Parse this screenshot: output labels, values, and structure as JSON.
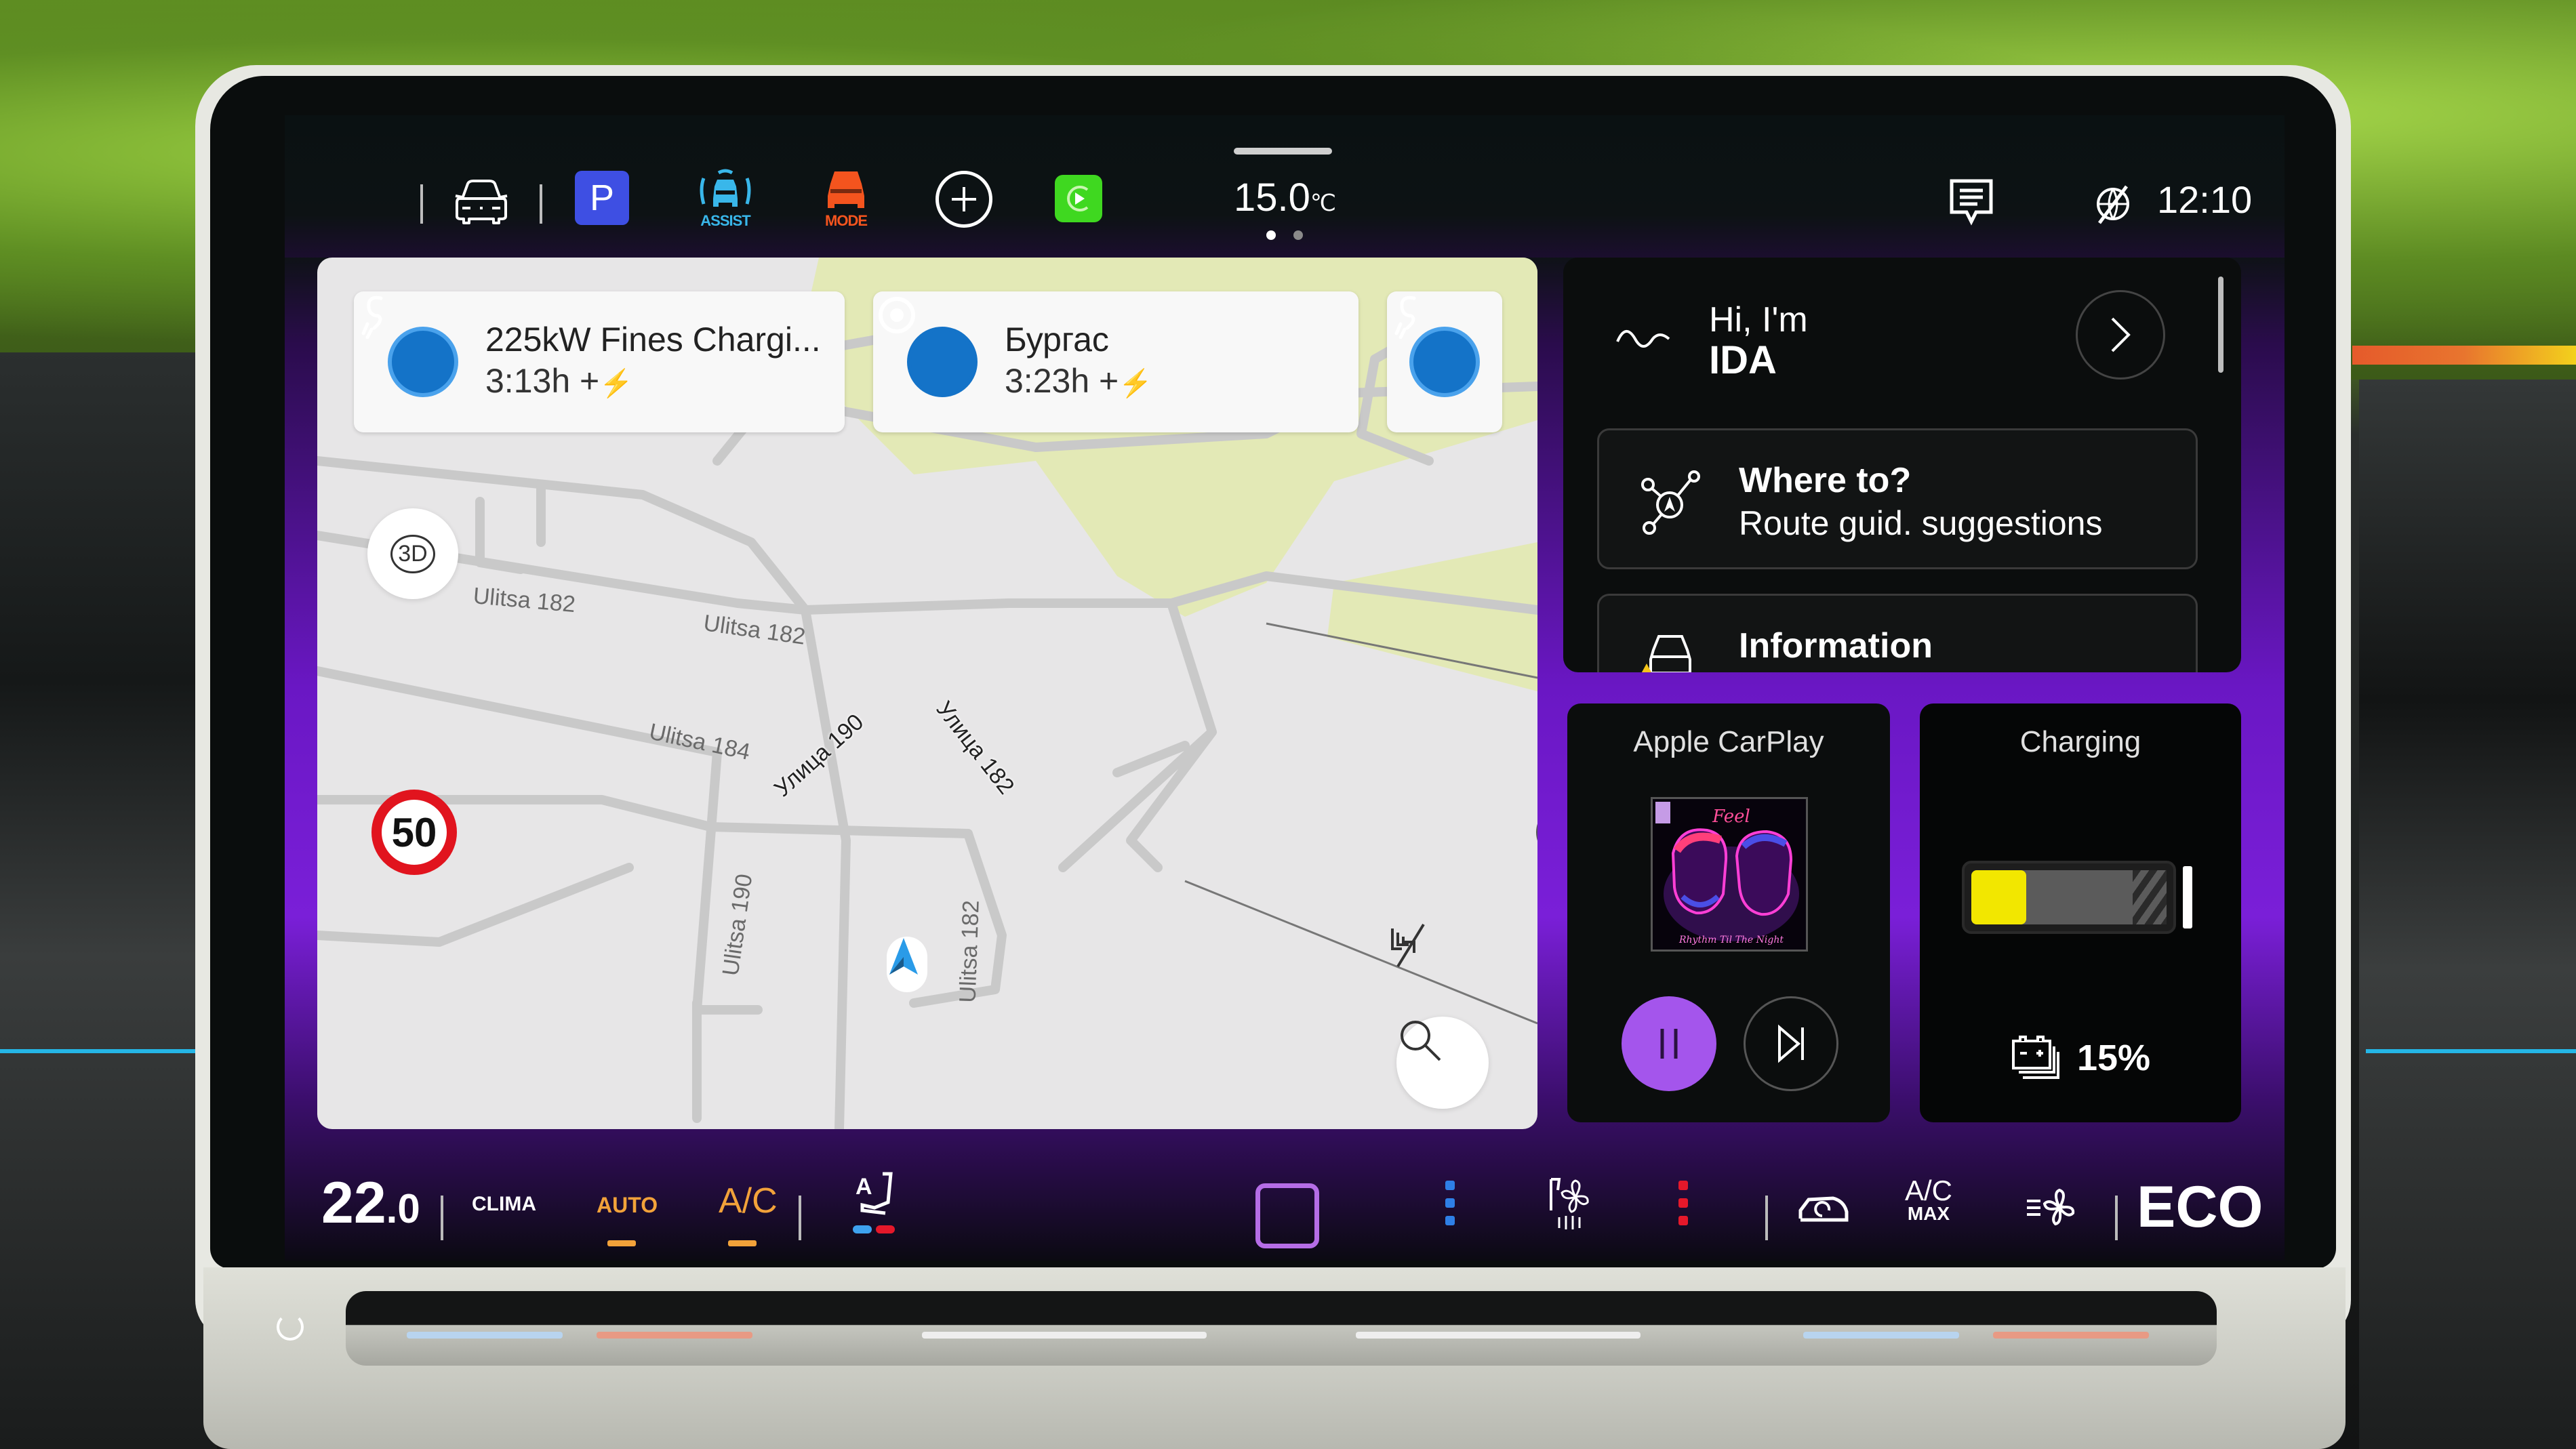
{
  "top_bar": {
    "apps_icon": "apps-grid-icon",
    "vehicle_icon": "car-front-icon",
    "park_label": "P",
    "assist_label": "ASSIST",
    "mode_label": "MODE",
    "add_icon": "plus-circle-icon",
    "carplay_icon": "carplay-icon",
    "outside_temp": "15.0",
    "outside_temp_unit": "℃",
    "page_count": 2,
    "active_page": 1,
    "messages_icon": "message-icon",
    "no_connection_icon": "connectivity-off-icon",
    "clock": "12:10"
  },
  "map": {
    "destinations": [
      {
        "icon": "charging-station-icon",
        "name": "225kW Fines Chargi...",
        "eta": "3:13h",
        "extra_icon": "charging-stop-icon",
        "prefix": "+"
      },
      {
        "icon": "destination-flag-icon",
        "name": "Бургас",
        "eta": "3:23h",
        "extra_icon": "charging-stop-icon",
        "prefix": "+"
      },
      {
        "icon": "charging-station-icon",
        "name": "",
        "eta": ""
      }
    ],
    "view_mode_button": "3D",
    "speed_limit": "50",
    "street_labels": [
      "Ulitsa 182",
      "Ulitsa 182",
      "Ulitsa 184",
      "Улица 190",
      "Улица 182",
      "Ulitsa 190",
      "Ulitsa 182"
    ],
    "search_icon": "search-icon",
    "traffic_off_icon": "traffic-off-icon",
    "position_icon": "navigation-arrow-icon",
    "colors": {
      "land": "#e7e6e7",
      "park": "#e3e9b6",
      "road": "#cfcfcf",
      "marker": "#2a9be8"
    }
  },
  "assistant": {
    "greeting": "Hi, I'm",
    "name": "IDA",
    "suggestions": [
      {
        "icon": "route-suggestions-icon",
        "title": "Where to?",
        "subtitle": "Route guid. suggestions"
      },
      {
        "icon": "car-warning-icon",
        "title": "Information",
        "subtitle": ""
      }
    ]
  },
  "media": {
    "title": "Apple CarPlay",
    "album_caption": "Rhythm Til The Night",
    "state": "playing",
    "pause_icon": "pause-icon",
    "next_icon": "skip-next-icon"
  },
  "charging": {
    "title": "Charging",
    "level_percent": 15,
    "level_label": "15%",
    "battery_icon": "battery-icon",
    "fill_color": "#f2e700"
  },
  "climate": {
    "set_temp_whole": "22",
    "set_temp_decimal": ".0",
    "clima_label": "CLIMA",
    "auto_label": "AUTO",
    "auto_active": true,
    "ac_label": "A/C",
    "ac_active": true,
    "seat_icon": "seat-auto-icon",
    "rear_defrost_active": true,
    "fan_cool_level": 3,
    "fan_heat_level": 3,
    "recirculation_icon": "recirculation-icon",
    "ac_max_top": "A/C",
    "ac_max_bottom": "MAX",
    "fan_icon": "fan-icon",
    "eco_label": "ECO",
    "colors": {
      "active": "#f2a23a",
      "cool": "#2e7fe6",
      "heat": "#e5182a",
      "accent": "#b56de6"
    }
  }
}
